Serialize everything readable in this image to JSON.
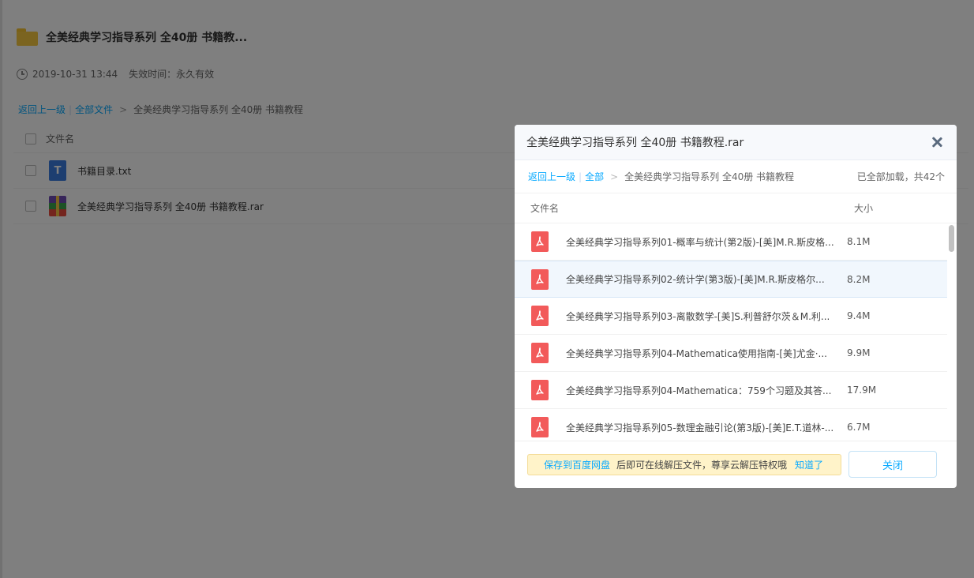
{
  "share": {
    "title": "全美经典学习指导系列 全40册 书籍教...",
    "date": "2019-10-31 13:44",
    "expire": "失效时间：永久有效",
    "breadcrumb": {
      "back": "返回上一级",
      "sep": "|",
      "all": "全部文件",
      "arrow": ">",
      "current": "全美经典学习指导系列 全40册 书籍教程"
    },
    "list_header": "文件名",
    "files": [
      {
        "name": "书籍目录.txt",
        "icon": "txt-file-icon",
        "icon_letter": "T"
      },
      {
        "name": "全美经典学习指导系列 全40册 书籍教程.rar",
        "icon": "rar-file-icon"
      }
    ]
  },
  "dialog": {
    "title": "全美经典学习指导系列 全40册 书籍教程.rar",
    "nav": {
      "back": "返回上一级",
      "sep": "|",
      "all": "全部",
      "arrow": ">",
      "path": "全美经典学习指导系列 全40册 书籍教程",
      "loaded": "已全部加载，共42个"
    },
    "columns": {
      "name": "文件名",
      "size": "大小"
    },
    "files": [
      {
        "name": "全美经典学习指导系列01-概率与统计(第2版)-[美]M.R.斯皮格...",
        "size": "8.1M"
      },
      {
        "name": "全美经典学习指导系列02-统计学(第3版)-[美]M.R.斯皮格尔...",
        "size": "8.2M"
      },
      {
        "name": "全美经典学习指导系列03-离散数学-[美]S.利普舒尔茨＆M.利...",
        "size": "9.4M"
      },
      {
        "name": "全美经典学习指导系列04-Mathematica使用指南-[美]尤金·...",
        "size": "9.9M"
      },
      {
        "name": "全美经典学习指导系列04-Mathematica：759个习题及其答...",
        "size": "17.9M"
      },
      {
        "name": "全美经典学习指导系列05-数理金融引论(第3版)-[美]E.T.道林-...",
        "size": "6.7M"
      }
    ],
    "selected_index": 1,
    "tip": {
      "save": "保存到百度网盘",
      "desc": "后即可在线解压文件，尊享云解压特权哦",
      "know": "知道了"
    },
    "close_label": "关闭"
  },
  "colors": {
    "link": "#09aaff",
    "pdf_icon": "#f25a5a",
    "folder": "#f7c840",
    "tip_bg": "#fff3c9"
  }
}
